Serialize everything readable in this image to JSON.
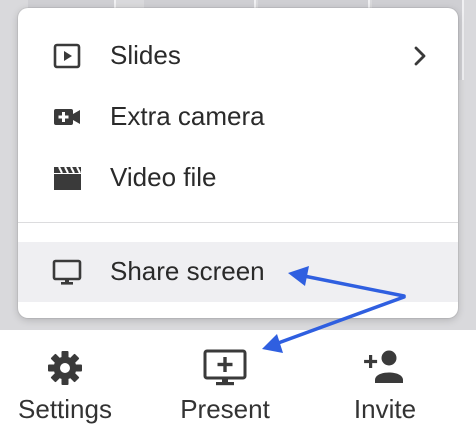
{
  "menu": {
    "items": [
      {
        "label": "Slides",
        "icon": "slides-play-icon",
        "has_submenu": true
      },
      {
        "label": "Extra camera",
        "icon": "video-camera-add-icon",
        "has_submenu": false
      },
      {
        "label": "Video file",
        "icon": "clapperboard-icon",
        "has_submenu": false
      }
    ],
    "share": {
      "label": "Share screen",
      "icon": "monitor-icon"
    }
  },
  "toolbar": {
    "settings_label": "Settings",
    "present_label": "Present",
    "invite_label": "Invite"
  },
  "colors": {
    "annotation_arrow": "#2f5fe0",
    "menu_highlight": "#efeff2",
    "icon": "#3a3a3a"
  }
}
